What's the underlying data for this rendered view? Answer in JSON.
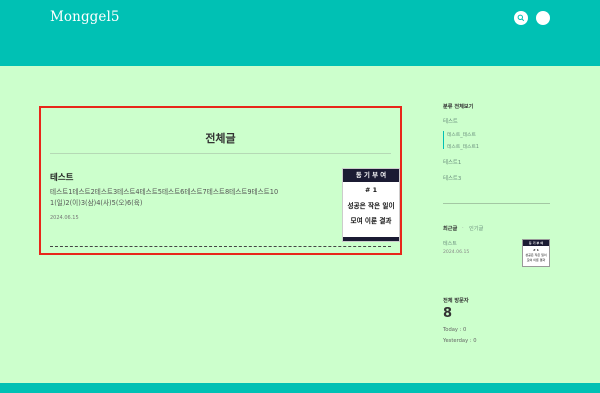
{
  "header": {
    "logo": "Monggel5",
    "search_icon": "search-icon",
    "menu_icon": "menu-icon",
    "accent_color": "#00c1b4"
  },
  "main": {
    "title": "전체글",
    "posts": [
      {
        "title": "테스트",
        "excerpt": "테스트1테스트2테스트3테스트4테스트5테스트6테스트7테스트8테스트9테스트10 1(일)2(이)3(삼)4(사)5(오)6(육)",
        "date": "2024.06.15",
        "thumb": {
          "header": "동 기 부 여",
          "number": "# 1",
          "line1": "성공은 작은 일이",
          "line2": "모여 이룬 결과"
        }
      }
    ]
  },
  "sidebar": {
    "category_title": "분류 전체보기",
    "categories": [
      "테스트",
      "테스트1",
      "테스트3"
    ],
    "subcategories": [
      "테스트_테스트",
      "테스트_테스트1"
    ],
    "tabs": {
      "recent": "최근글",
      "popular": "인기글"
    },
    "recent_post": {
      "title": "테스트",
      "date": "2024.06.15",
      "thumb": {
        "header": "동 기 부 여",
        "number": "# 1",
        "line1": "성공은 작은 일이",
        "line2": "모여 이룬 결과"
      }
    },
    "visitors": {
      "title": "전체 방문자",
      "total": "8",
      "today": "Today : 0",
      "yesterday": "Yesterday : 0"
    }
  }
}
